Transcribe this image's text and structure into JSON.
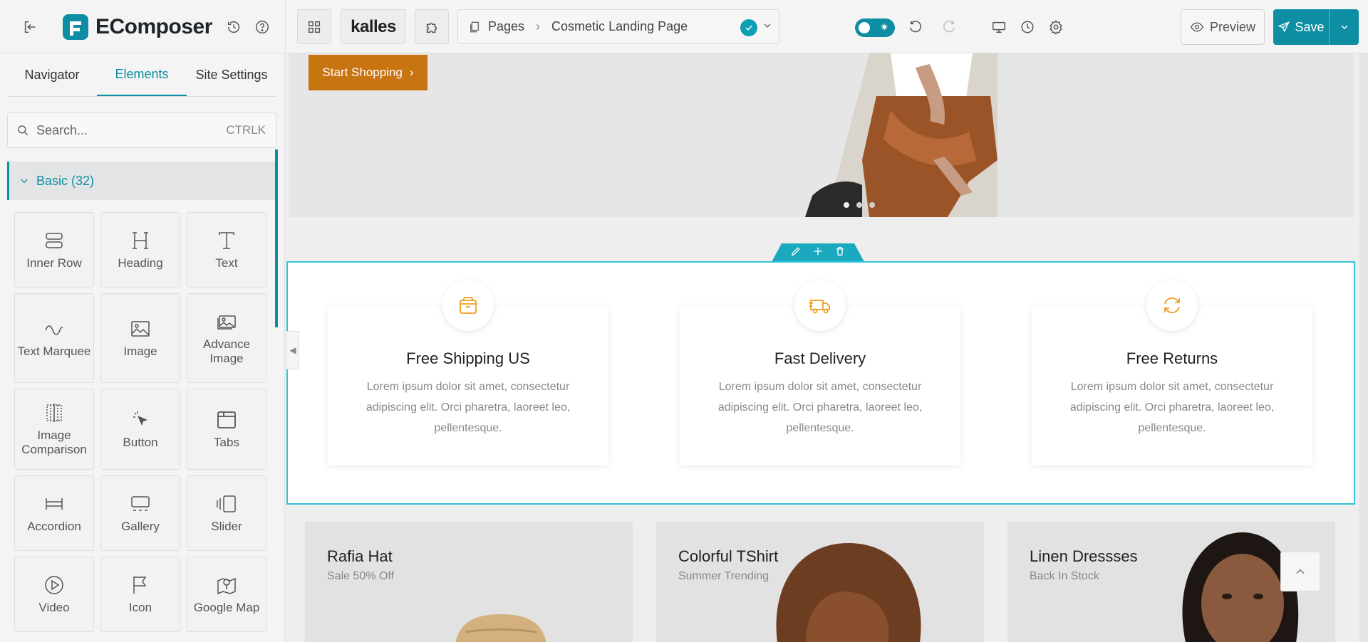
{
  "app": {
    "brand_name": "EComposer",
    "store_logo_text": "kalles",
    "accent_color": "#0d8ea3"
  },
  "breadcrumb": {
    "root": "Pages",
    "current": "Cosmetic Landing Page"
  },
  "topbar": {
    "preview_label": "Preview",
    "save_label": "Save"
  },
  "sidebar": {
    "tabs": [
      {
        "label": "Navigator"
      },
      {
        "label": "Elements",
        "active": true
      },
      {
        "label": "Site Settings"
      }
    ],
    "search": {
      "placeholder": "Search...",
      "shortcut": "CTRLK"
    },
    "category": {
      "label": "Basic (32)"
    },
    "elements": [
      {
        "label": "Inner Row",
        "icon": "inner-row-icon"
      },
      {
        "label": "Heading",
        "icon": "heading-icon"
      },
      {
        "label": "Text",
        "icon": "text-icon"
      },
      {
        "label": "Text Marquee",
        "icon": "marquee-icon"
      },
      {
        "label": "Image",
        "icon": "image-icon"
      },
      {
        "label": "Advance Image",
        "icon": "advance-image-icon"
      },
      {
        "label": "Image Comparison",
        "icon": "image-comparison-icon"
      },
      {
        "label": "Button",
        "icon": "button-icon"
      },
      {
        "label": "Tabs",
        "icon": "tabs-icon"
      },
      {
        "label": "Accordion",
        "icon": "accordion-icon"
      },
      {
        "label": "Gallery",
        "icon": "gallery-icon"
      },
      {
        "label": "Slider",
        "icon": "slider-icon"
      },
      {
        "label": "Video",
        "icon": "video-icon"
      },
      {
        "label": "Icon",
        "icon": "flag-icon"
      },
      {
        "label": "Google Map",
        "icon": "map-icon"
      }
    ]
  },
  "canvas": {
    "hero": {
      "button_label": "Start Shopping"
    },
    "features": [
      {
        "title": "Free Shipping US",
        "description": "Lorem ipsum dolor sit amet, consectetur adipiscing elit. Orci pharetra, laoreet leo, pellentesque.",
        "icon": "box-icon"
      },
      {
        "title": "Fast Delivery",
        "description": "Lorem ipsum dolor sit amet, consectetur adipiscing elit. Orci pharetra, laoreet leo, pellentesque.",
        "icon": "truck-icon"
      },
      {
        "title": "Free Returns",
        "description": "Lorem ipsum dolor sit amet, consectetur adipiscing elit. Orci pharetra, laoreet leo, pellentesque.",
        "icon": "refresh-icon"
      }
    ],
    "products": [
      {
        "title": "Rafia Hat",
        "subtitle": "Sale 50% Off"
      },
      {
        "title": "Colorful TShirt",
        "subtitle": "Summer Trending"
      },
      {
        "title": "Linen Dressses",
        "subtitle": "Back In Stock"
      }
    ]
  }
}
